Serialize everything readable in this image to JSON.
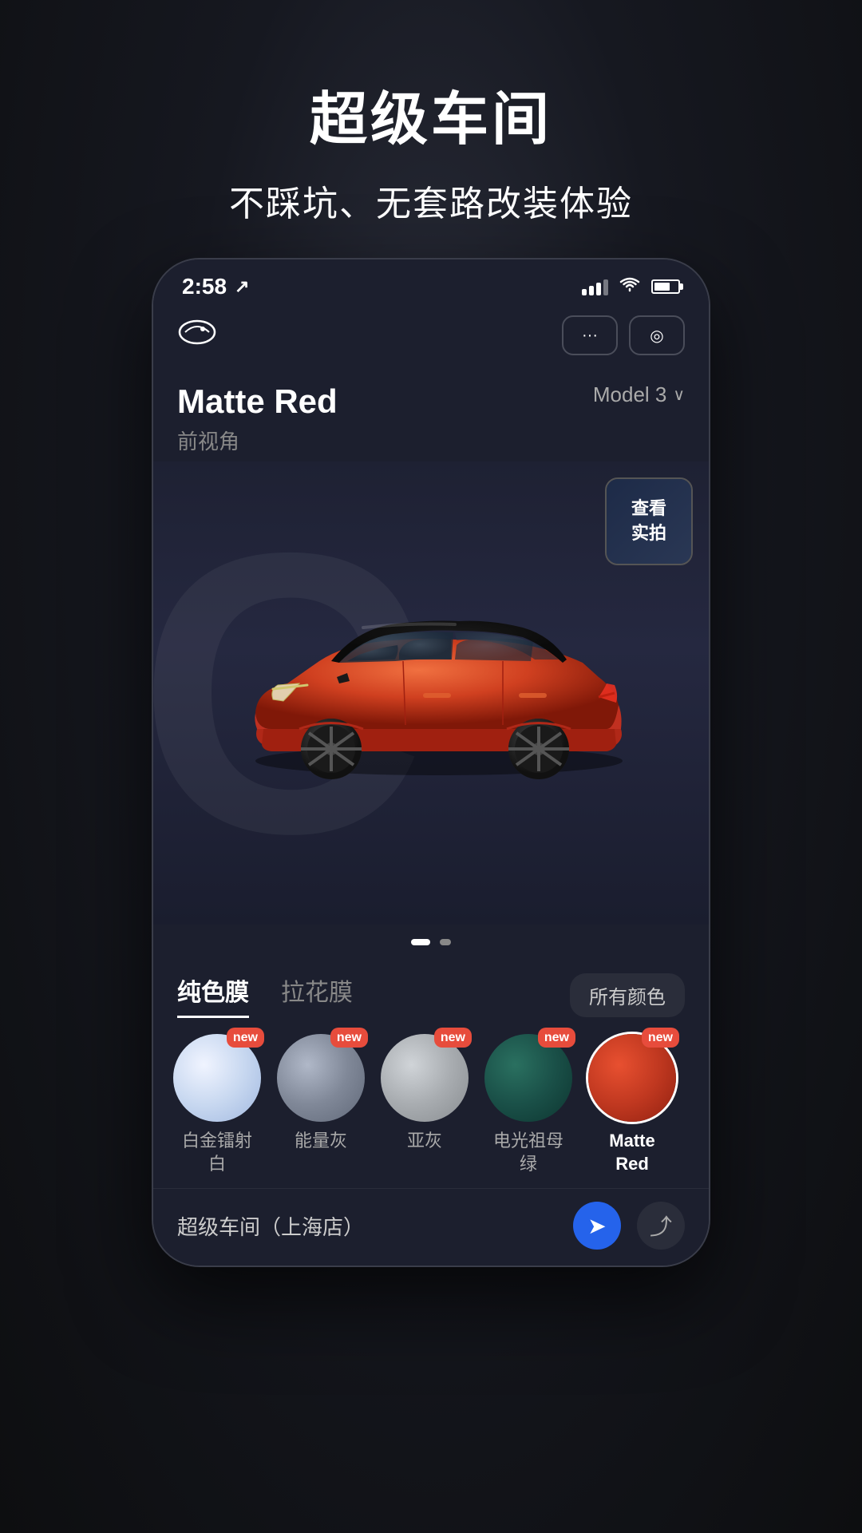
{
  "page": {
    "bg_title": "超级车间",
    "bg_subtitle": "不踩坑、无套路改装体验"
  },
  "status_bar": {
    "time": "2:58",
    "location_icon": "▸",
    "signal_bars": [
      3,
      5,
      7,
      10,
      14
    ],
    "battery_level": 60
  },
  "nav": {
    "logo": "⊕",
    "more_dots": "···",
    "record_icon": "◎"
  },
  "car_info": {
    "color_name": "Matte Red",
    "angle": "前视角",
    "model": "Model 3",
    "chevron": "∨"
  },
  "real_shot": {
    "label": "查看\n实拍"
  },
  "page_dots": [
    {
      "active": true
    },
    {
      "active": false
    }
  ],
  "film_tabs": [
    {
      "label": "纯色膜",
      "active": true
    },
    {
      "label": "拉花膜",
      "active": false
    }
  ],
  "all_colors_btn": "所有颜色",
  "swatches": [
    {
      "id": "platinum-white",
      "label": "白金镭射\n白",
      "color": "radial-gradient(circle at 35% 35%, #f0f4ff, #c8d8f0, #a0b8e0)",
      "new": true,
      "active": false
    },
    {
      "id": "energy-gray",
      "label": "能量灰",
      "color": "radial-gradient(circle at 35% 35%, #b0b8c8, #808898, #606878)",
      "new": true,
      "active": false
    },
    {
      "id": "ash-gray",
      "label": "亚灰",
      "color": "radial-gradient(circle at 35% 35%, #d0d4d8, #a8acb0, #888c90)",
      "new": true,
      "active": false
    },
    {
      "id": "electric-teal",
      "label": "电光祖母\n绿",
      "color": "radial-gradient(circle at 35% 35%, #2a7060, #1a5048, #0d3530)",
      "new": true,
      "active": false
    },
    {
      "id": "matte-red",
      "label": "Matte\nRed",
      "color": "radial-gradient(circle at 35% 35%, #e85030, #c03820, #902010)",
      "new": true,
      "active": true
    }
  ],
  "bottom_bar": {
    "store_name": "超级车间（上海店）",
    "nav_icon": "➤",
    "share_icon": "⤴"
  }
}
